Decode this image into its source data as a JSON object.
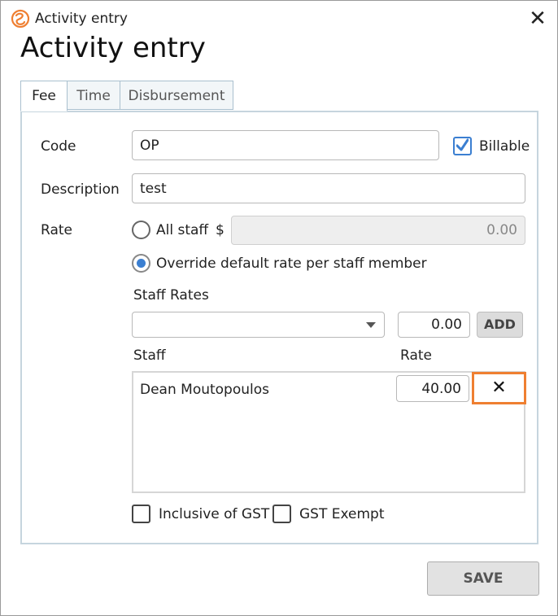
{
  "window": {
    "title": "Activity entry",
    "close_symbol": "✕",
    "heading": "Activity entry",
    "logo_icon": "swirl-logo-icon",
    "accent_color": "#ef7f31"
  },
  "tabs": [
    {
      "label": "Fee",
      "active": true
    },
    {
      "label": "Time",
      "active": false
    },
    {
      "label": "Disbursement",
      "active": false
    }
  ],
  "form": {
    "code_label": "Code",
    "code_value": "OP",
    "billable_label": "Billable",
    "billable_checked": true,
    "description_label": "Description",
    "description_value": "test",
    "rate_label": "Rate",
    "all_staff_label": "All staff",
    "currency_symbol": "$",
    "all_staff_rate": "0.00",
    "override_label": "Override default rate per staff member",
    "rate_mode": "override",
    "staff_rates_label": "Staff Rates",
    "staff_select_value": "",
    "new_rate_value": "0.00",
    "add_label": "ADD",
    "staff_column": "Staff",
    "rate_column": "Rate",
    "staff_rows": [
      {
        "name": "Dean Moutopoulos",
        "rate": "40.00",
        "remove_symbol": "✕"
      }
    ],
    "inclusive_gst_label": "Inclusive of GST",
    "inclusive_gst_checked": false,
    "gst_exempt_label": "GST Exempt",
    "gst_exempt_checked": false
  },
  "footer": {
    "save_label": "SAVE"
  }
}
